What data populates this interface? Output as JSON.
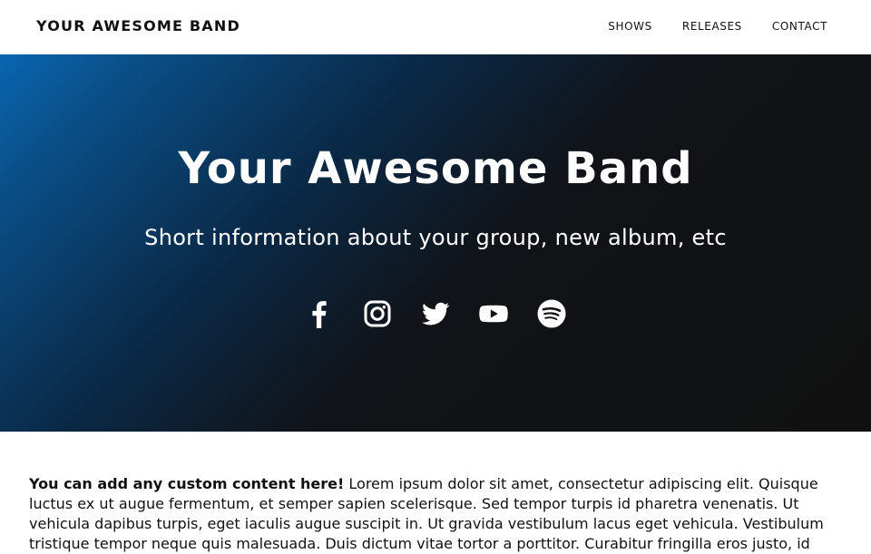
{
  "navbar": {
    "brand": "YOUR AWESOME BAND",
    "links": [
      {
        "label": "SHOWS"
      },
      {
        "label": "RELEASES"
      },
      {
        "label": "CONTACT"
      }
    ]
  },
  "hero": {
    "title": "Your Awesome Band",
    "subtitle": "Short information about your group, new album, etc",
    "social_icons": [
      "facebook-icon",
      "instagram-icon",
      "twitter-icon",
      "youtube-icon",
      "spotify-icon"
    ],
    "gradient_colors": [
      "#0a66b0",
      "#111111"
    ]
  },
  "content": {
    "lead": "You can add any custom content here!",
    "body": " Lorem ipsum dolor sit amet, consectetur adipiscing elit. Quisque luctus ex ut augue fermentum, et semper sapien scelerisque. Sed tempor turpis id pharetra venenatis. Ut vehicula dapibus turpis, eget iaculis augue suscipit in. Ut gravida vestibulum lacus eget vehicula. Vestibulum tristique tempor neque quis malesuada. Duis dictum vitae tortor a porttitor. Curabitur fringilla eros justo, id"
  }
}
